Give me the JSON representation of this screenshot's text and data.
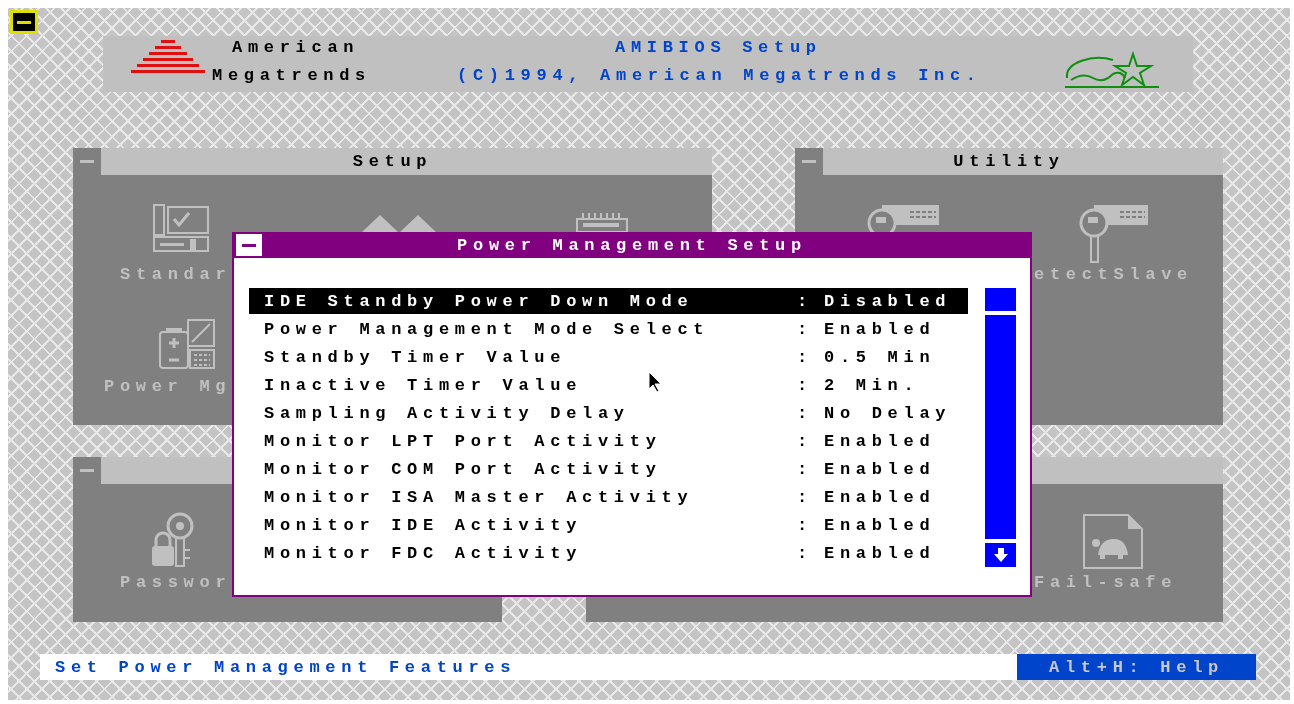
{
  "header": {
    "brand": [
      "American",
      "Megatrends"
    ],
    "title": "AMIBIOS Setup",
    "copyright": "(C)1994, American Megatrends Inc."
  },
  "windows": [
    {
      "title": "Setup",
      "control_box": true,
      "items": [
        {
          "kind": "standard",
          "label": "Standar"
        },
        {
          "kind": "mountains"
        },
        {
          "kind": "chip"
        },
        {
          "kind": "power",
          "label": "Power Mg"
        }
      ]
    },
    {
      "title": "Utility",
      "control_box": true,
      "items": [
        {
          "kind": "card"
        },
        {
          "kind": "card-key",
          "label": "etectSlave"
        }
      ]
    },
    {
      "control_box": true,
      "items": [
        {
          "kind": "password",
          "label": "Passwor"
        }
      ]
    },
    {
      "control_box": false,
      "items": [
        {
          "kind": "failsafe",
          "label": "Fail-safe"
        }
      ]
    }
  ],
  "dialog": {
    "title": "Power Management Setup",
    "rows": [
      {
        "label": "IDE Standby Power Down Mode",
        "separator": ":",
        "value": "Disabled",
        "selected": true
      },
      {
        "label": "Power Management Mode Select",
        "separator": ":",
        "value": "Enabled",
        "selected": false
      },
      {
        "label": "Standby Timer Value",
        "separator": ":",
        "value": "0.5 Min",
        "selected": false
      },
      {
        "label": "Inactive Timer Value",
        "separator": ":",
        "value": "2 Min.",
        "selected": false
      },
      {
        "label": "Sampling Activity Delay",
        "separator": ":",
        "value": "No Delay",
        "selected": false
      },
      {
        "label": "Monitor LPT Port Activity",
        "separator": ":",
        "value": "Enabled",
        "selected": false
      },
      {
        "label": "Monitor COM Port Activity",
        "separator": ":",
        "value": "Enabled",
        "selected": false
      },
      {
        "label": "Monitor ISA Master Activity",
        "separator": ":",
        "value": "Enabled",
        "selected": false
      },
      {
        "label": "Monitor IDE Activity",
        "separator": ":",
        "value": "Enabled",
        "selected": false
      },
      {
        "label": "Monitor FDC Activity",
        "separator": ":",
        "value": "Enabled",
        "selected": false
      }
    ]
  },
  "status_bar": {
    "hint": "Set Power Management Features",
    "help": "Alt+H: Help"
  }
}
